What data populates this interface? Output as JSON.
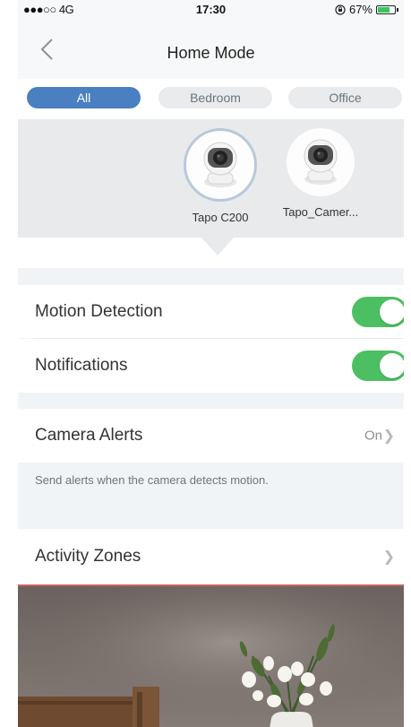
{
  "status_bar": {
    "carrier": "●●●○○ 4G",
    "time": "17:30",
    "battery": "67%",
    "battery_level": 0.67
  },
  "header": {
    "title": "Home Mode"
  },
  "tabs": [
    {
      "label": "All",
      "active": true
    },
    {
      "label": "Bedroom",
      "active": false
    },
    {
      "label": "Office",
      "active": false
    }
  ],
  "cameras": [
    {
      "name": "Tapo C200",
      "selected": true
    },
    {
      "name": "Tapo_Camer...",
      "selected": false
    }
  ],
  "settings": {
    "motion_detection": {
      "label": "Motion Detection",
      "enabled": true
    },
    "notifications": {
      "label": "Notifications",
      "enabled": true
    },
    "camera_alerts": {
      "label": "Camera Alerts",
      "value": "On",
      "hint": "Send alerts when the camera detects motion."
    },
    "activity_zones": {
      "label": "Activity Zones"
    }
  },
  "colors": {
    "accent": "#4a7fc1",
    "toggle_on": "#4cbf62"
  }
}
